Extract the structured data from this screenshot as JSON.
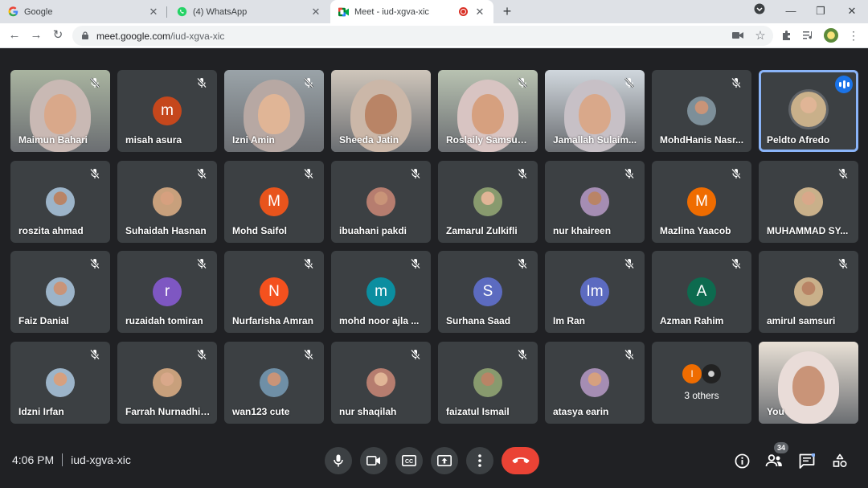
{
  "browser": {
    "tabs": [
      {
        "title": "Google",
        "icon": "google-icon"
      },
      {
        "title": "(4) WhatsApp",
        "icon": "whatsapp-icon"
      },
      {
        "title": "Meet - iud-xgva-xic",
        "icon": "meet-icon",
        "active": true
      }
    ],
    "url_host": "meet.google.com",
    "url_path": "/iud-xgva-xic"
  },
  "participants": [
    {
      "name": "Maimun Bahari",
      "type": "video",
      "muted": true
    },
    {
      "name": "misah asura",
      "type": "letter",
      "letter": "m",
      "color": "#c5471c",
      "muted": true
    },
    {
      "name": "Izni Amin",
      "type": "video",
      "muted": true
    },
    {
      "name": "Sheeda Jatin",
      "type": "video",
      "muted": false
    },
    {
      "name": "Roslaily Samsudin",
      "type": "video",
      "muted": true
    },
    {
      "name": "Jamallah Sulaim...",
      "type": "video",
      "muted": true
    },
    {
      "name": "MohdHanis Nasr...",
      "type": "photo",
      "muted": true
    },
    {
      "name": "Peldto Afredo",
      "type": "photo",
      "muted": false,
      "speaking": true
    },
    {
      "name": "roszita ahmad",
      "type": "photo",
      "muted": true
    },
    {
      "name": "Suhaidah Hasnan",
      "type": "photo",
      "muted": true
    },
    {
      "name": "Mohd Saifol",
      "type": "letter",
      "letter": "M",
      "color": "#e8541c",
      "muted": true
    },
    {
      "name": "ibuahani pakdi",
      "type": "photo",
      "muted": true
    },
    {
      "name": "Zamarul Zulkifli",
      "type": "photo",
      "muted": true
    },
    {
      "name": "nur khaireen",
      "type": "photo",
      "muted": true
    },
    {
      "name": "Mazlina Yaacob",
      "type": "letter",
      "letter": "M",
      "color": "#ef6c00",
      "muted": true
    },
    {
      "name": "MUHAMMAD SY...",
      "type": "photo",
      "muted": true
    },
    {
      "name": "Faiz Danial",
      "type": "photo",
      "muted": true
    },
    {
      "name": "ruzaidah tomiran",
      "type": "letter",
      "letter": "r",
      "color": "#7e57c2",
      "muted": true
    },
    {
      "name": "Nurfarisha Amran",
      "type": "letter",
      "letter": "N",
      "color": "#f4511e",
      "muted": true
    },
    {
      "name": "mohd noor ajla ...",
      "type": "letter",
      "letter": "m",
      "color": "#0b8ea0",
      "muted": true
    },
    {
      "name": "Surhana Saad",
      "type": "letter",
      "letter": "S",
      "color": "#5c6bc0",
      "muted": true
    },
    {
      "name": "Im Ran",
      "type": "letter",
      "letter": "Im",
      "color": "#5c6bc0",
      "muted": true
    },
    {
      "name": "Azman Rahim",
      "type": "letter",
      "letter": "A",
      "color": "#0d6b4f",
      "muted": true
    },
    {
      "name": "amirul samsuri",
      "type": "photo",
      "muted": true
    },
    {
      "name": "Idzni Irfan",
      "type": "photo",
      "muted": true
    },
    {
      "name": "Farrah Nurnadhir...",
      "type": "photo",
      "muted": true
    },
    {
      "name": "wan123 cute",
      "type": "photo",
      "muted": true
    },
    {
      "name": "nur shaqilah",
      "type": "photo",
      "muted": true
    },
    {
      "name": "faizatul Ismail",
      "type": "photo",
      "muted": true
    },
    {
      "name": "atasya earin",
      "type": "photo",
      "muted": true
    },
    {
      "name": "3 others",
      "type": "others",
      "letter": "I",
      "color": "#ef6c00",
      "muted": false
    },
    {
      "name": "You",
      "type": "video",
      "muted": false
    }
  ],
  "meeting": {
    "time": "4:06 PM",
    "code": "iud-xgva-xic",
    "participant_count": "34"
  }
}
